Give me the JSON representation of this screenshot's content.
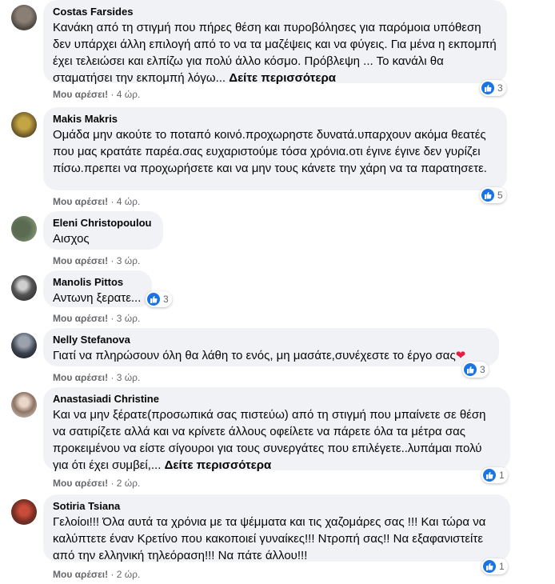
{
  "comments": [
    {
      "author": "Costas Farsides",
      "text": "Κανάκη από τη στιγμή που πήρες θέση και πυροβόλησες για παρόμοια υπόθεση δεν υπάρχει άλλη επιλογή από το να τα μαζέψεις και να φύγεις. Για μένα η εκπομπή έχει τελειώσει και ελπίζω για πολύ άλλο κόσμο. Πρόβλεψη ... Το κανάλι θα σταματήσει την εκπομπή λόγω...",
      "see_more": "Δείτε περισσότερα",
      "like": "Μου αρέσει!",
      "sep": "·",
      "time": "4 ώρ.",
      "reactions": "3"
    },
    {
      "author": "Makis Makris",
      "text": "Ομάδα μην ακούτε το ποταπό κοινό.προχωρηστε δυνατά.υπαρχουν ακόμα θεατές που μας κρατάτε παρέα.σας ευχαριστούμε τόσα χρόνια.οτι έγινε έγινε δεν γυρίζει πίσω.πρεπει να προχωρήσετε και να μην τους κάνετε την χάρη να τα παρατησετε.",
      "like": "Μου αρέσει!",
      "sep": "·",
      "time": "4 ώρ.",
      "reactions": "5"
    },
    {
      "author": "Eleni Christopoulou",
      "text": "Αισχος",
      "like": "Μου αρέσει!",
      "sep": "·",
      "time": "3 ώρ."
    },
    {
      "author": "Manolis Pittos",
      "text": "Αντωνη ξερατε...",
      "like": "Μου αρέσει!",
      "sep": "·",
      "time": "3 ώρ.",
      "reactions": "3"
    },
    {
      "author": "Nelly Stefanova",
      "text": "Γιατί να πληρώσουν όλη θα λάθη το ενός, μη μασάτε,συνέχεστε το έργο σας",
      "heart": "❤",
      "like": "Μου αρέσει!",
      "sep": "·",
      "time": "3 ώρ.",
      "reactions": "3"
    },
    {
      "author": "Anastasiadi Christine",
      "text": "Και να μην ξέρατε(προσωπικά σας πιστεύω) από τη στιγμή που μπαίνετε σε θέση να σατιρίζετε αλλά και να κρίνετε άλλους οφείλετε να πάρετε όλα τα μέτρα σας προκειμένου να είστε σίγουροι για τους συνεργάτες που επιλέγετε..λυπάμαι πολύ για ότι έχει συμβεί,...",
      "see_more": "Δείτε περισσότερα",
      "like": "Μου αρέσει!",
      "sep": "·",
      "time": "2 ώρ.",
      "reactions": "1"
    },
    {
      "author": "Sotiria Tsiana",
      "text": "Γελοίοι!!! Όλα αυτά τα χρόνια με τα ψέμματα και τις χαζομάρες σας !!! Και τώρα να καλύπτετε έναν Κρετίνο που κακοποιεί γυναίκες!!! Ντροπή σας!! Να εξαφανιστείτε από την ελληνική τηλεόραση!!! Να πάτε άλλου!!!",
      "like": "Μου αρέσει!",
      "sep": "·",
      "time": "2 ώρ.",
      "reactions": "1"
    }
  ]
}
